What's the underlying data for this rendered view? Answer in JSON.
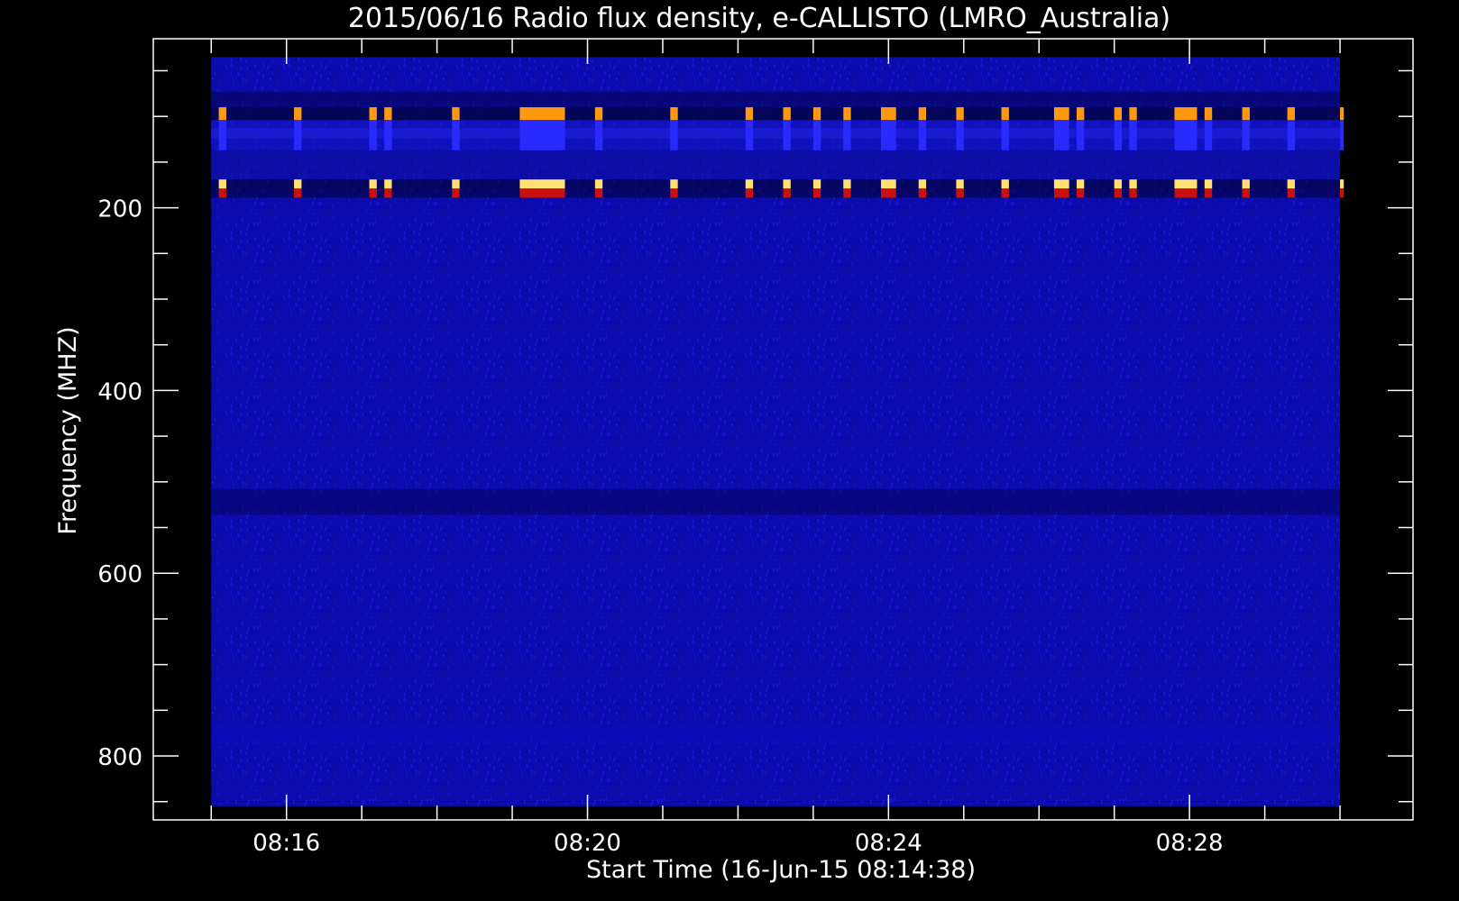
{
  "chart_data": {
    "type": "heatmap",
    "title": "2015/06/16  Radio flux density, e-CALLISTO (LMRO_Australia)",
    "xlabel": "Start Time (16-Jun-15 08:14:38)",
    "ylabel": "Frequency (MHZ)",
    "x_axis": {
      "ticks": [
        "08:16",
        "08:20",
        "08:24",
        "08:28"
      ],
      "tick_minutes": [
        16,
        20,
        24,
        28
      ],
      "range_minutes": [
        14.23,
        30.97
      ],
      "data_range_minutes": [
        15.0,
        30.0
      ]
    },
    "y_axis": {
      "ticks": [
        "200",
        "400",
        "600",
        "800"
      ],
      "tick_values": [
        200,
        400,
        600,
        800
      ],
      "minor_step": 50,
      "range": [
        870,
        15
      ],
      "inverted": true,
      "data_range": [
        35,
        855
      ]
    },
    "colormap": [
      "#000000",
      "#0b0b90",
      "#1a1ad8",
      "#2a2aff",
      "#c81010",
      "#ff3a00",
      "#ff9a10",
      "#ffe070"
    ],
    "background_color": "#0b0bb0",
    "interference_bands_mhz": [
      [
        73,
        104
      ],
      [
        90,
        104
      ],
      [
        104,
        137
      ],
      [
        113,
        124
      ],
      [
        137,
        169
      ],
      [
        169,
        179
      ],
      [
        179,
        189
      ],
      [
        508,
        536
      ],
      [
        766,
        788
      ]
    ],
    "rfi_bursts_minutes": [
      [
        15.1,
        15.2
      ],
      [
        17.1,
        17.2
      ],
      [
        19.1,
        19.7
      ],
      [
        20.1,
        20.2
      ],
      [
        21.1,
        21.2
      ],
      [
        22.1,
        22.2
      ],
      [
        23.0,
        23.1
      ],
      [
        23.4,
        23.5
      ],
      [
        23.9,
        24.1
      ],
      [
        24.9,
        25.0
      ],
      [
        25.5,
        25.6
      ],
      [
        26.2,
        26.4
      ],
      [
        27.0,
        27.1
      ],
      [
        27.8,
        28.1
      ],
      [
        28.7,
        28.8
      ],
      [
        29.3,
        29.4
      ],
      [
        30.0,
        30.05
      ],
      [
        16.1,
        16.2
      ],
      [
        18.2,
        18.3
      ],
      [
        17.3,
        17.4
      ],
      [
        22.6,
        22.7
      ],
      [
        24.4,
        24.5
      ],
      [
        26.5,
        26.6
      ],
      [
        27.2,
        27.3
      ],
      [
        28.2,
        28.3
      ]
    ]
  }
}
